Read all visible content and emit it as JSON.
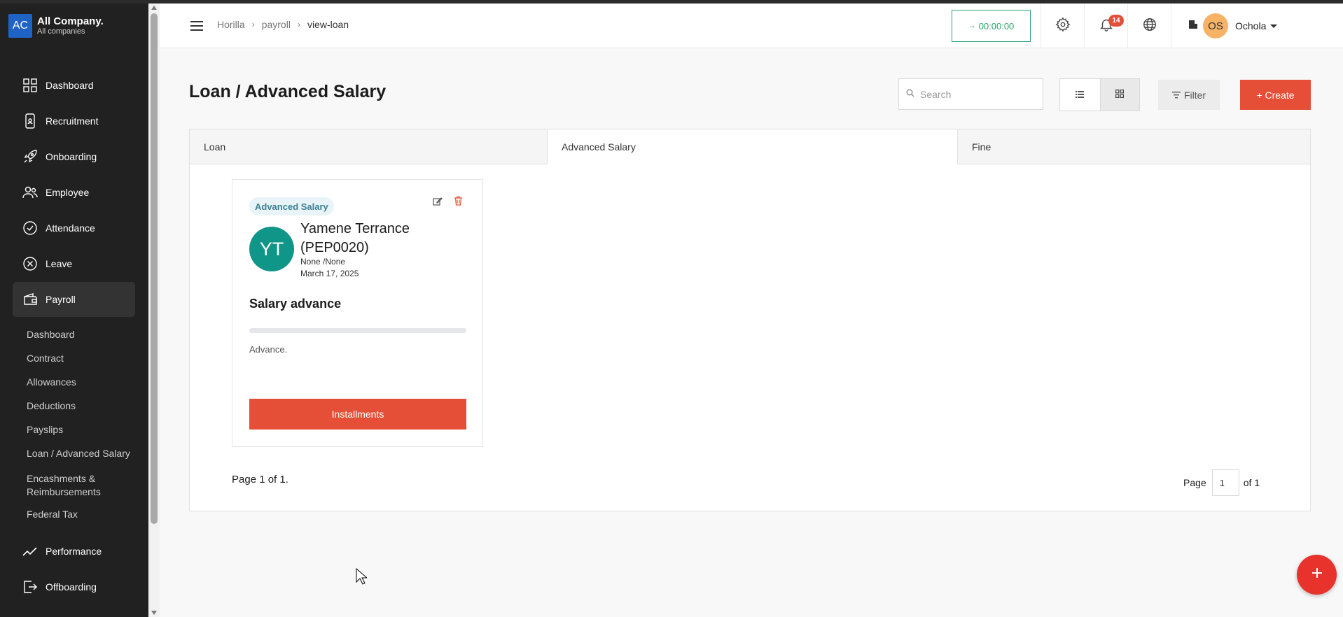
{
  "company": {
    "logo_text": "AC",
    "name": "All Company.",
    "subtitle": "All companies"
  },
  "sidebar": {
    "items": [
      {
        "label": "Dashboard",
        "icon": "grid-icon"
      },
      {
        "label": "Recruitment",
        "icon": "mobile-icon"
      },
      {
        "label": "Onboarding",
        "icon": "rocket-icon"
      },
      {
        "label": "Employee",
        "icon": "users-icon"
      },
      {
        "label": "Attendance",
        "icon": "check-circle-icon"
      },
      {
        "label": "Leave",
        "icon": "x-circle-icon"
      },
      {
        "label": "Payroll",
        "icon": "wallet-icon",
        "active": true
      },
      {
        "label": "Performance",
        "icon": "trend-icon"
      },
      {
        "label": "Offboarding",
        "icon": "exit-icon"
      }
    ],
    "payroll_sub": [
      "Dashboard",
      "Contract",
      "Allowances",
      "Deductions",
      "Payslips",
      "Loan / Advanced Salary",
      "Encashments & Reimbursements",
      "Federal Tax"
    ]
  },
  "header": {
    "breadcrumb": [
      "Horilla",
      "payroll",
      "view-loan"
    ],
    "timer": "00:00:00",
    "notification_count": "14",
    "user": {
      "initials": "OS",
      "name": "Ochola"
    }
  },
  "page": {
    "title": "Loan / Advanced Salary",
    "search_placeholder": "Search",
    "filter_label": "Filter",
    "create_label": "+ Create",
    "tabs": [
      "Loan",
      "Advanced Salary",
      "Fine"
    ],
    "active_tab": "Advanced Salary"
  },
  "card": {
    "tag": "Advanced Salary",
    "avatar_initials": "YT",
    "employee_name": "Yamene Terrance (PEP0020)",
    "dept": "None /None",
    "date": "March 17, 2025",
    "title": "Salary advance",
    "progress": 0,
    "description": "Advance.",
    "button_label": "Installments"
  },
  "pagination": {
    "info": "Page 1 of 1.",
    "page_label": "Page",
    "current": "1",
    "of_label": "of 1"
  },
  "colors": {
    "accent": "#e54f38",
    "timer": "#2aa36b",
    "sidebar": "#212121",
    "avatar": "#0f9688"
  }
}
